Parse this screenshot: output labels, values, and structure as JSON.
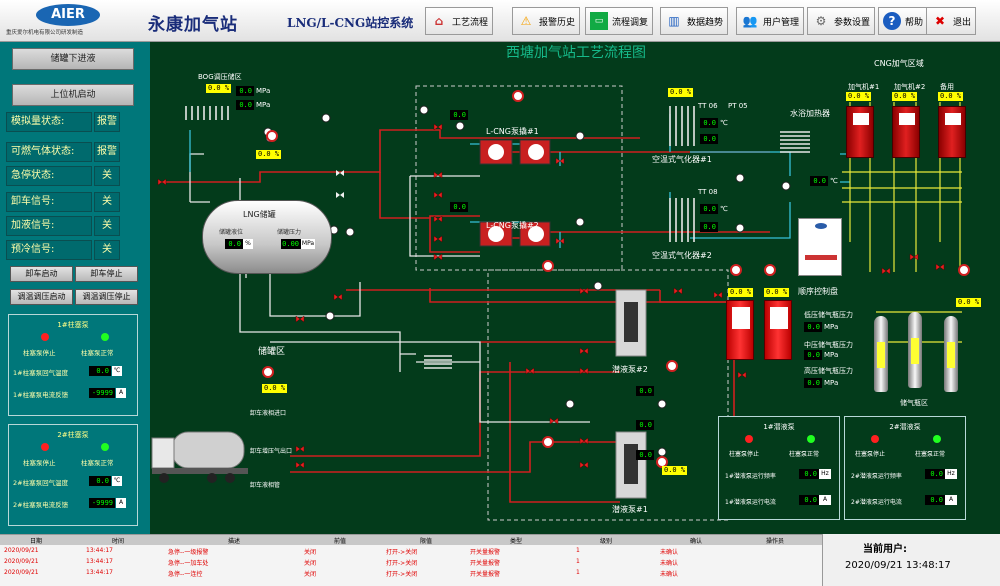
{
  "header": {
    "logo": "AIER",
    "company": "重庆爱尔机电有限公司研发制造",
    "station_name": "永康加气站",
    "system_title": "LNG/L-CNG站控系统",
    "toolbar": [
      {
        "label": "工艺流程",
        "icon": "house-icon"
      },
      {
        "label": "报警历史",
        "icon": "warning-icon"
      },
      {
        "label": "流程调复",
        "icon": "monitor-icon"
      },
      {
        "label": "数据趋势",
        "icon": "chart-icon"
      },
      {
        "label": "用户管理",
        "icon": "users-icon"
      },
      {
        "label": "参数设置",
        "icon": "gear-icon"
      },
      {
        "label": "帮助",
        "icon": "help-icon"
      },
      {
        "label": "退出",
        "icon": "exit-icon"
      }
    ]
  },
  "left": {
    "btn_downlink": "储罐下进液",
    "btn_upstart": "上位机启动",
    "status": [
      {
        "label": "模拟量状态:",
        "value": "报警"
      },
      {
        "label": "可燃气体状态:",
        "value": "报警"
      },
      {
        "label": "急停状态:",
        "value": "关"
      },
      {
        "label": "卸车信号:",
        "value": "关"
      },
      {
        "label": "加液信号:",
        "value": "关"
      },
      {
        "label": "预冷信号:",
        "value": "关"
      }
    ],
    "btn_unload_start": "卸车启动",
    "btn_unload_stop": "卸车停止",
    "btn_pressure_start": "调温调压启动",
    "btn_pressure_stop": "调温调压停止",
    "pump1": {
      "title": "1#柱塞泵",
      "stop": "柱塞泵停止",
      "normal": "柱塞泵正常",
      "temp_label": "1#柱塞泵回气温度",
      "temp_value": "0.0",
      "temp_unit": "℃",
      "current_label": "1#柱塞泵电流反馈",
      "current_value": "-9999",
      "current_unit": "A"
    },
    "pump2": {
      "title": "2#柱塞泵",
      "stop": "柱塞泵停止",
      "normal": "柱塞泵正常",
      "temp_label": "2#柱塞泵回气温度",
      "temp_value": "0.0",
      "temp_unit": "℃",
      "current_label": "2#柱塞泵电流反馈",
      "current_value": "-9999",
      "current_unit": "A"
    }
  },
  "process": {
    "title": "西塘加气站工艺流程图",
    "bog_label": "BOG调压储区",
    "bog_pct": "0.0 %",
    "bog_mpa": "0.0",
    "bog_unit": "MPa",
    "pct_a": "0.0 %",
    "tank_label": "LNG储罐",
    "tank_level_label": "储罐液位",
    "tank_pressure_label": "储罐压力",
    "tank_level": "0.0",
    "tank_level_unit": "%",
    "tank_pressure": "0.00",
    "tank_pressure_unit": "MPa",
    "storage_zone": "储罐区",
    "storage_pct": "0.0 %",
    "lcng_pump1": "L-CNG泵撬#1",
    "lcng_pump2": "L-CNG泵撬#2",
    "lcng_top_pct": "0.0 %",
    "vaporizer1": "空温式气化器#1",
    "vaporizer2": "空温式气化器#2",
    "vap_pct": "0.0 %",
    "tt06": "TT 06",
    "pt05": "PT 05",
    "tt08": "TT 08",
    "water_heater": "水浴加热器",
    "cng_zone": "CNG加气区域",
    "dispensers": [
      {
        "name": "加气机#1",
        "pct": "0.0 %"
      },
      {
        "name": "加气机#2",
        "pct": "0.0 %"
      },
      {
        "name": "备用",
        "pct": "0.0 %"
      }
    ],
    "control_panel": "顺序控制盘",
    "seq_low": "低压储气瓶压力",
    "seq_mid": "中压储气瓶压力",
    "seq_high": "高压储气瓶压力",
    "seq_value": "0.0",
    "seq_unit": "MPa",
    "cylinder_zone": "储气瓶区",
    "submerged1": "潜液泵#1",
    "submerged2": "潜液泵#2",
    "lng_disp_pct": "0.0 %",
    "sub_pct": "0.0 %",
    "unload_inlet": "卸车液相进口",
    "unload_gas": "卸车增压气出口",
    "unload_vent": "卸车液相管",
    "temp_unit": "℃",
    "zero": "0.0",
    "pump_panel1": {
      "title": "1#潜液泵",
      "stop": "柱塞泵停止",
      "normal": "柱塞泵正常",
      "freq_label": "1#潜液泵运行频率",
      "freq_value": "0.0",
      "freq_unit": "Hz",
      "current_label": "1#潜液泵运行电流",
      "current_value": "0.0",
      "current_unit": "A"
    },
    "pump_panel2": {
      "title": "2#潜液泵",
      "stop": "柱塞泵停止",
      "normal": "柱塞泵正常",
      "freq_label": "2#潜液泵运行频率",
      "freq_value": "0.0",
      "freq_unit": "Hz",
      "current_label": "2#潜液泵运行电流",
      "current_value": "0.0",
      "current_unit": "A"
    }
  },
  "alarm_table": {
    "headers": [
      "日期",
      "时间",
      "描述",
      "前值",
      "限值",
      "类型",
      "级别",
      "确认",
      "操作员"
    ],
    "rows": [
      [
        "2020/09/21",
        "13:44:17",
        "急停--一级报警",
        "关闭",
        "打开->关闭",
        "开关量报警",
        "1",
        "未确认",
        ""
      ],
      [
        "2020/09/21",
        "13:44:17",
        "急停--一加车处",
        "关闭",
        "打开->关闭",
        "开关量报警",
        "1",
        "未确认",
        ""
      ],
      [
        "2020/09/21",
        "13:44:17",
        "急停--一连控",
        "关闭",
        "打开->关闭",
        "开关量报警",
        "1",
        "未确认",
        ""
      ]
    ]
  },
  "user_info": {
    "label": "当前用户:",
    "datetime": "2020/09/21 13:48:17"
  }
}
